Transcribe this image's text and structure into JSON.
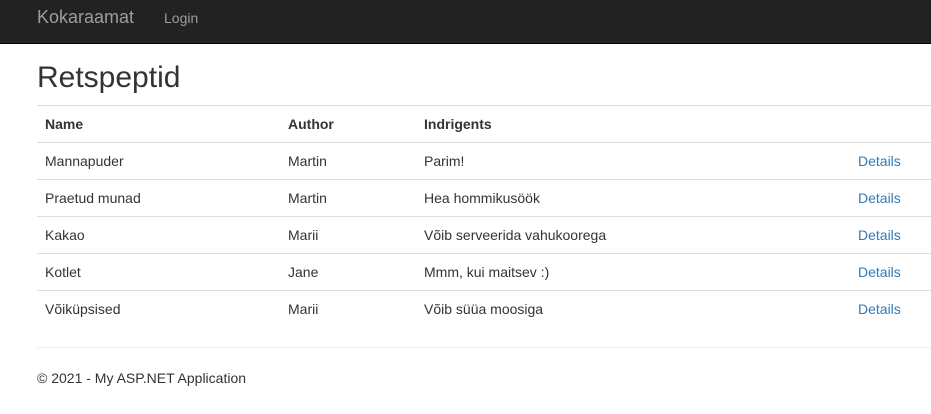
{
  "navbar": {
    "brand": "Kokaraamat",
    "links": [
      {
        "label": "Login"
      }
    ]
  },
  "page": {
    "title": "Retspeptid"
  },
  "table": {
    "headers": {
      "name": "Name",
      "author": "Author",
      "ingredients": "Indrigents",
      "action": ""
    },
    "rows": [
      {
        "name": "Mannapuder",
        "author": "Martin",
        "ingredients": "Parim!",
        "action": "Details"
      },
      {
        "name": "Praetud munad",
        "author": "Martin",
        "ingredients": "Hea hommikusöök",
        "action": "Details"
      },
      {
        "name": "Kakao",
        "author": "Marii",
        "ingredients": "Võib serveerida vahukoorega",
        "action": "Details"
      },
      {
        "name": "Kotlet",
        "author": "Jane",
        "ingredients": "Mmm, kui maitsev :)",
        "action": "Details"
      },
      {
        "name": "Võiküpsised",
        "author": "Marii",
        "ingredients": "Võib süüa moosiga",
        "action": "Details"
      }
    ]
  },
  "footer": {
    "text": "© 2021 - My ASP.NET Application"
  },
  "colors": {
    "navbar_bg": "#222222",
    "navbar_text": "#9d9d9d",
    "link": "#337ab7",
    "border": "#dddddd"
  }
}
